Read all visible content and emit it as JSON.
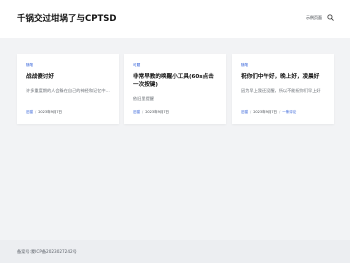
{
  "header": {
    "site_title": "千锅交过坩埚了与CPTSD",
    "nav_link": "示例页面",
    "search_icon": "search-icon"
  },
  "posts": [
    {
      "category": "随笔",
      "title": "战战傻讨好",
      "excerpt": "许多重度期的人会躲在自己的神经和记忆中…",
      "author": "旧猫",
      "date": "2023年9月7日",
      "comment": ""
    },
    {
      "category": "可题",
      "title": "非常早教的唤醒小工具(60s点击一次按键)",
      "excerpt": "依旧里提醒",
      "author": "旧猫",
      "date": "2023年9月7日",
      "comment": ""
    },
    {
      "category": "随笔",
      "title": "祝你们中午好，晚上好，凌晨好",
      "excerpt": "因为早上我还没醒，所以不能祝你们早上好",
      "author": "旧猫",
      "date": "2023年9月7日",
      "comment": "一条评论"
    }
  ],
  "footer": {
    "icp": "备案号:蒙ICP备2023027242号"
  }
}
